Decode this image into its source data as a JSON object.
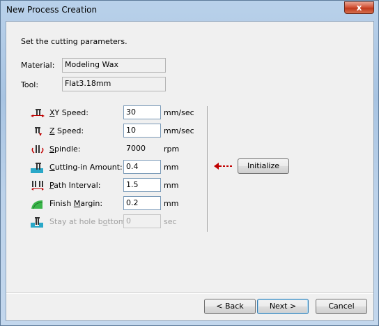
{
  "window": {
    "title": "New Process Creation",
    "close_glyph": "x"
  },
  "instruction": "Set the cutting parameters.",
  "material": {
    "label": "Material:",
    "value": "Modeling Wax"
  },
  "tool": {
    "label": "Tool:",
    "value": "Flat3.18mm"
  },
  "params": [
    {
      "label": "XY Speed:",
      "value": "30",
      "unit": "mm/sec",
      "icon": "xy-speed-icon",
      "enabled": true,
      "editable": true
    },
    {
      "label": "Z Speed:",
      "value": "10",
      "unit": "mm/sec",
      "icon": "z-speed-icon",
      "enabled": true,
      "editable": true
    },
    {
      "label": "Spindle:",
      "value": "7000",
      "unit": "rpm",
      "icon": "spindle-icon",
      "enabled": true,
      "editable": false
    },
    {
      "label": "Cutting-in Amount:",
      "value": "0.4",
      "unit": "mm",
      "icon": "cutting-in-icon",
      "enabled": true,
      "editable": true
    },
    {
      "label": "Path Interval:",
      "value": "1.5",
      "unit": "mm",
      "icon": "path-interval-icon",
      "enabled": true,
      "editable": true
    },
    {
      "label": "Finish Margin:",
      "value": "0.2",
      "unit": "mm",
      "icon": "finish-margin-icon",
      "enabled": true,
      "editable": true
    },
    {
      "label": "Stay at hole bottom:",
      "value": "0",
      "unit": "sec",
      "icon": "stay-hole-icon",
      "enabled": false,
      "editable": false
    }
  ],
  "initialize": {
    "label": "Initialize",
    "arrow_icon": "left-arrow-icon"
  },
  "buttons": {
    "back": "< Back",
    "next": "Next >",
    "cancel": "Cancel"
  },
  "colors": {
    "accent_icon": "#2aa8c8",
    "arrow": "#c00000",
    "green": "#3bb54a"
  }
}
